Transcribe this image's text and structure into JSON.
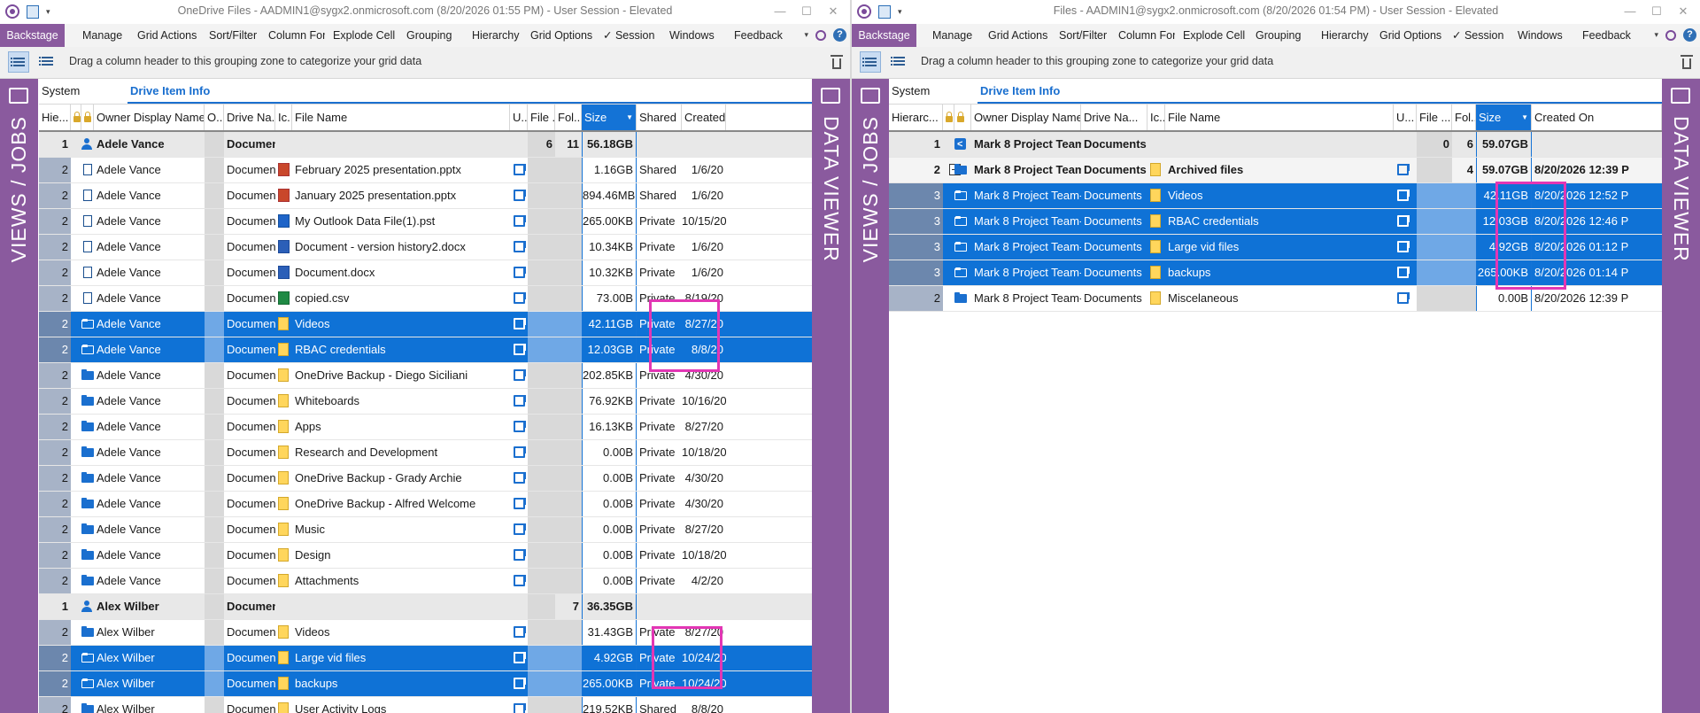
{
  "left": {
    "title": "OneDrive Files - AADMIN1@sygx2.onmicrosoft.com (8/20/2026 01:55 PM) - User Session - Elevated",
    "menu": [
      "Backstage",
      "Manage",
      "Grid Actions",
      "Sort/Filter",
      "Column Forr",
      "Explode Cell",
      "Grouping",
      "Hierarchy",
      "Grid Options",
      "✓ Session",
      "Windows",
      "Feedback"
    ],
    "grouping_hint": "Drag a column header to this grouping zone to categorize your grid data",
    "band_system": "System",
    "band_info": "Drive Item Info",
    "sidebar_left": "VIEWS / JOBS",
    "sidebar_right": "DATA VIEWER",
    "headers": [
      "Hie...",
      "",
      "",
      "Owner Display Name",
      "O...",
      "Drive Na...",
      "Ic...",
      "File Name",
      "U...",
      "File ...",
      "Fol...",
      "Size",
      "Shared",
      "Created"
    ],
    "rows": [
      {
        "type": "group",
        "lvl": "1",
        "owner": "Adele Vance",
        "drive": "Documents",
        "name": "",
        "files": "6",
        "folders": "11",
        "size": "56.18GB",
        "shared": "",
        "created": "",
        "icon": "person"
      },
      {
        "type": "row",
        "lvl": "2",
        "owner": "Adele Vance",
        "drive": "Documents",
        "ft": "ppt",
        "name": "February 2025 presentation.pptx",
        "size": "1.16GB",
        "shared": "Shared",
        "created": "1/6/20",
        "icon": "doc"
      },
      {
        "type": "row",
        "lvl": "2",
        "owner": "Adele Vance",
        "drive": "Documents",
        "ft": "ppt",
        "name": "January 2025 presentation.pptx",
        "size": "894.46MB",
        "shared": "Shared",
        "created": "1/6/20",
        "icon": "doc"
      },
      {
        "type": "row",
        "lvl": "2",
        "owner": "Adele Vance",
        "drive": "Documents",
        "ft": "pst",
        "name": "My Outlook Data File(1).pst",
        "size": "265.00KB",
        "shared": "Private",
        "created": "10/15/20",
        "icon": "doc"
      },
      {
        "type": "row",
        "lvl": "2",
        "owner": "Adele Vance",
        "drive": "Documents",
        "ft": "docx",
        "name": "Document - version history2.docx",
        "size": "10.34KB",
        "shared": "Private",
        "created": "1/6/20",
        "icon": "doc"
      },
      {
        "type": "row",
        "lvl": "2",
        "owner": "Adele Vance",
        "drive": "Documents",
        "ft": "docx",
        "name": "Document.docx",
        "size": "10.32KB",
        "shared": "Private",
        "created": "1/6/20",
        "icon": "doc"
      },
      {
        "type": "row",
        "lvl": "2",
        "owner": "Adele Vance",
        "drive": "Documents",
        "ft": "csv",
        "name": "copied.csv",
        "size": "73.00B",
        "shared": "Private",
        "created": "8/19/20",
        "icon": "doc"
      },
      {
        "type": "sel",
        "lvl": "2",
        "owner": "Adele Vance",
        "drive": "Documents",
        "ft": "folder",
        "name": "Videos",
        "size": "42.11GB",
        "shared": "Private",
        "created": "8/27/20",
        "icon": "folder"
      },
      {
        "type": "sel",
        "lvl": "2",
        "owner": "Adele Vance",
        "drive": "Documents",
        "ft": "folder",
        "name": "RBAC credentials",
        "size": "12.03GB",
        "shared": "Private",
        "created": "8/8/20",
        "icon": "folder"
      },
      {
        "type": "row",
        "lvl": "2",
        "owner": "Adele Vance",
        "drive": "Documents",
        "ft": "folder",
        "name": "OneDrive Backup - Diego Siciliani",
        "size": "202.85KB",
        "shared": "Private",
        "created": "4/30/20",
        "icon": "folder"
      },
      {
        "type": "row",
        "lvl": "2",
        "owner": "Adele Vance",
        "drive": "Documents",
        "ft": "folder",
        "name": "Whiteboards",
        "size": "76.92KB",
        "shared": "Private",
        "created": "10/16/20",
        "icon": "folder"
      },
      {
        "type": "row",
        "lvl": "2",
        "owner": "Adele Vance",
        "drive": "Documents",
        "ft": "folder",
        "name": "Apps",
        "size": "16.13KB",
        "shared": "Private",
        "created": "8/27/20",
        "icon": "folder"
      },
      {
        "type": "row",
        "lvl": "2",
        "owner": "Adele Vance",
        "drive": "Documents",
        "ft": "folder",
        "name": "Research and Development",
        "size": "0.00B",
        "shared": "Private",
        "created": "10/18/20",
        "icon": "folder"
      },
      {
        "type": "row",
        "lvl": "2",
        "owner": "Adele Vance",
        "drive": "Documents",
        "ft": "folder",
        "name": "OneDrive Backup - Grady Archie",
        "size": "0.00B",
        "shared": "Private",
        "created": "4/30/20",
        "icon": "folder"
      },
      {
        "type": "row",
        "lvl": "2",
        "owner": "Adele Vance",
        "drive": "Documents",
        "ft": "folder",
        "name": "OneDrive Backup - Alfred Welcome",
        "size": "0.00B",
        "shared": "Private",
        "created": "4/30/20",
        "icon": "folder"
      },
      {
        "type": "row",
        "lvl": "2",
        "owner": "Adele Vance",
        "drive": "Documents",
        "ft": "folder",
        "name": "Music",
        "size": "0.00B",
        "shared": "Private",
        "created": "8/27/20",
        "icon": "folder"
      },
      {
        "type": "row",
        "lvl": "2",
        "owner": "Adele Vance",
        "drive": "Documents",
        "ft": "folder",
        "name": "Design",
        "size": "0.00B",
        "shared": "Private",
        "created": "10/18/20",
        "icon": "folder"
      },
      {
        "type": "row",
        "lvl": "2",
        "owner": "Adele Vance",
        "drive": "Documents",
        "ft": "folder",
        "name": "Attachments",
        "size": "0.00B",
        "shared": "Private",
        "created": "4/2/20",
        "icon": "folder"
      },
      {
        "type": "group",
        "lvl": "1",
        "owner": "Alex Wilber",
        "drive": "Documents",
        "name": "",
        "files": "",
        "folders": "7",
        "size": "36.35GB",
        "shared": "",
        "created": "",
        "icon": "person"
      },
      {
        "type": "row",
        "lvl": "2",
        "owner": "Alex Wilber",
        "drive": "Documents",
        "ft": "folder",
        "name": "Videos",
        "size": "31.43GB",
        "shared": "Private",
        "created": "8/27/20",
        "icon": "folder"
      },
      {
        "type": "sel",
        "lvl": "2",
        "owner": "Alex Wilber",
        "drive": "Documents",
        "ft": "folder",
        "name": "Large vid files",
        "size": "4.92GB",
        "shared": "Private",
        "created": "10/24/20",
        "icon": "folder"
      },
      {
        "type": "sel",
        "lvl": "2",
        "owner": "Alex Wilber",
        "drive": "Documents",
        "ft": "folder",
        "name": "backups",
        "size": "265.00KB",
        "shared": "Private",
        "created": "10/24/20",
        "icon": "folder"
      },
      {
        "type": "row",
        "lvl": "2",
        "owner": "Alex Wilber",
        "drive": "Documents",
        "ft": "folder",
        "name": "User Activity Logs",
        "size": "219.52KB",
        "shared": "Shared",
        "created": "8/8/20",
        "icon": "folder"
      }
    ]
  },
  "right": {
    "title": "Files - AADMIN1@sygx2.onmicrosoft.com (8/20/2026 01:54 PM) - User Session - Elevated",
    "menu": [
      "Backstage",
      "Manage",
      "Grid Actions",
      "Sort/Filter",
      "Column Forr",
      "Explode Cell",
      "Grouping",
      "Hierarchy",
      "Grid Options",
      "✓ Session",
      "Windows",
      "Feedback"
    ],
    "grouping_hint": "Drag a column header to this grouping zone to categorize your grid data",
    "band_system": "System",
    "band_info": "Drive Item Info",
    "sidebar_left": "VIEWS / JOBS",
    "sidebar_right": "DATA VIEWER",
    "headers": [
      "Hierarc...",
      "",
      "",
      "Owner Display Name",
      "Drive Na...",
      "Ic...",
      "File Name",
      "U...",
      "File ...",
      "Fol...",
      "Size",
      "Created On"
    ],
    "rows": [
      {
        "type": "group",
        "lvl": "1",
        "owner": "Mark 8 Project Team",
        "drive": "Documents",
        "name": "",
        "files": "0",
        "folders": "6",
        "size": "59.07GB",
        "created": "",
        "icon": "share"
      },
      {
        "type": "sub",
        "lvl": "2",
        "owner": "Mark 8 Project Team",
        "drive": "Documents",
        "ft": "folder",
        "name": "Archived files",
        "files": "",
        "folders": "4",
        "size": "59.07GB",
        "created": "8/20/2026 12:39 P",
        "icon": "folder"
      },
      {
        "type": "sel",
        "lvl": "3",
        "owner": "Mark 8 Project Team-",
        "drive": "Documents",
        "ft": "folder",
        "name": "Videos",
        "size": "42.11GB",
        "created": "8/20/2026 12:52 P",
        "icon": "folder"
      },
      {
        "type": "sel",
        "lvl": "3",
        "owner": "Mark 8 Project Team-",
        "drive": "Documents",
        "ft": "folder",
        "name": "RBAC credentials",
        "size": "12.03GB",
        "created": "8/20/2026 12:46 P",
        "icon": "folder"
      },
      {
        "type": "sel",
        "lvl": "3",
        "owner": "Mark 8 Project Team-",
        "drive": "Documents",
        "ft": "folder",
        "name": "Large vid files",
        "size": "4.92GB",
        "created": "8/20/2026 01:12 P",
        "icon": "folder"
      },
      {
        "type": "sel",
        "lvl": "3",
        "owner": "Mark 8 Project Team-",
        "drive": "Documents",
        "ft": "folder",
        "name": "backups",
        "size": "265.00KB",
        "created": "8/20/2026 01:14 P",
        "icon": "folder"
      },
      {
        "type": "row",
        "lvl": "2",
        "owner": "Mark 8 Project Team-",
        "drive": "Documents",
        "ft": "folder",
        "name": "Miscelaneous",
        "size": "0.00B",
        "created": "8/20/2026 12:39 P",
        "icon": "folder"
      }
    ]
  }
}
